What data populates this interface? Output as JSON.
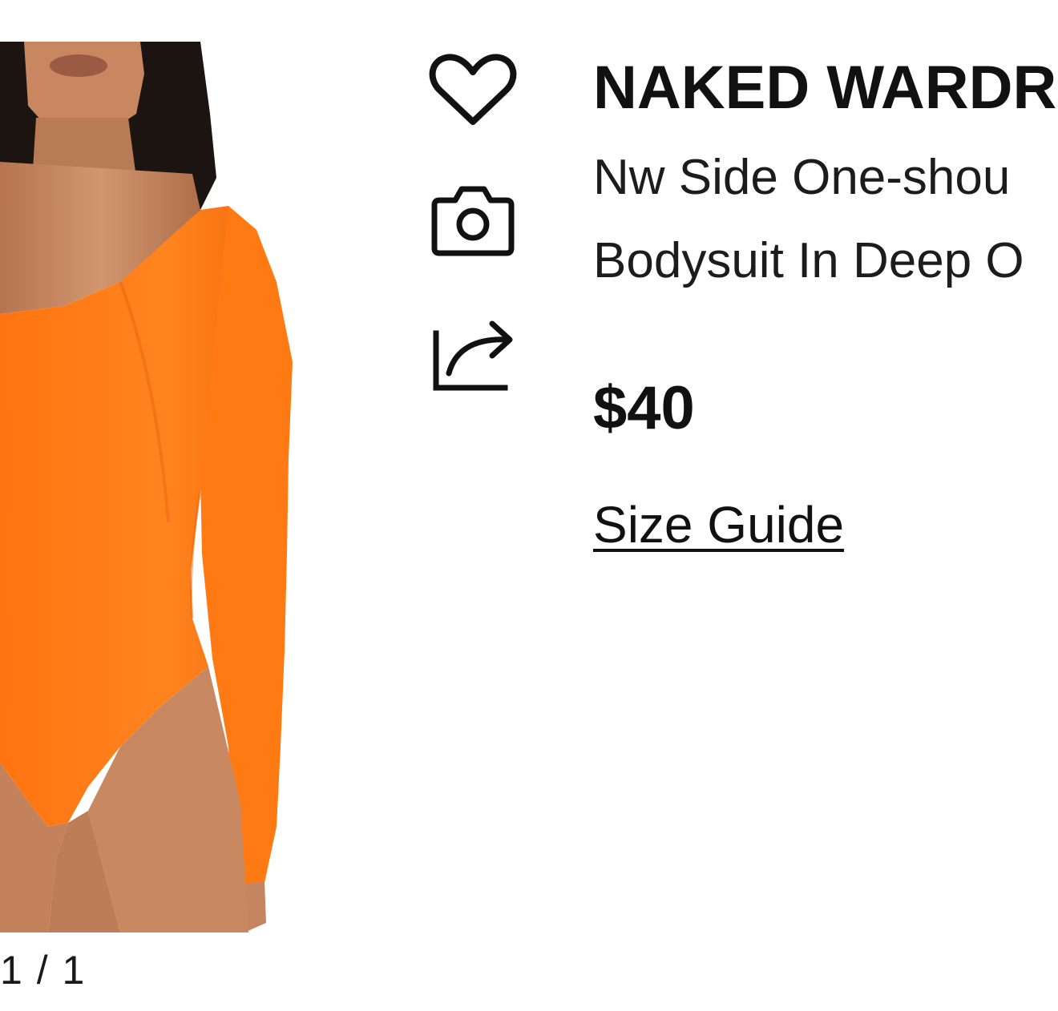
{
  "product": {
    "brand": "NAKED WARDR",
    "title_line_1": "Nw Side One-shou",
    "title_line_2": "Bodysuit In Deep O",
    "price": "$40",
    "size_guide_label": "Size Guide"
  },
  "gallery": {
    "counter": "1 / 1"
  },
  "actions": {
    "favorite_icon": "heart-icon",
    "camera_icon": "camera-icon",
    "share_icon": "share-icon"
  },
  "colors": {
    "bodysuit": "#ff7a10",
    "skin": "#c98a62",
    "hair": "#1b1410",
    "text": "#111111"
  }
}
